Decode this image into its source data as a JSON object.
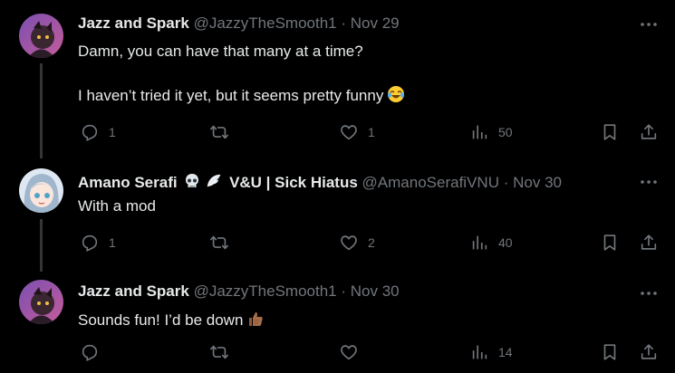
{
  "tweets": [
    {
      "name": "Jazz and Spark",
      "handle": "@JazzyTheSmooth1",
      "dot": "·",
      "date": "Nov 29",
      "text_lines": [
        "Damn, you can have that many at a time?",
        "I haven’t tried it yet, but it seems pretty funny"
      ],
      "replies": "1",
      "reposts": "",
      "likes": "1",
      "views": "50"
    },
    {
      "name": "Amano Serafi",
      "name_suffix": "V&U | Sick Hiatus",
      "handle": "@AmanoSerafiVNU",
      "dot": "·",
      "date": "Nov 30",
      "text_lines": [
        "With a mod"
      ],
      "replies": "1",
      "reposts": "",
      "likes": "2",
      "views": "40"
    },
    {
      "name": "Jazz and Spark",
      "handle": "@JazzyTheSmooth1",
      "dot": "·",
      "date": "Nov 30",
      "text_lines": [
        "Sounds fun! I’d be down"
      ],
      "replies": "",
      "reposts": "",
      "likes": "",
      "views": "14"
    }
  ],
  "icons": {
    "reply": "reply-icon",
    "repost": "repost-icon",
    "like": "heart-icon",
    "views": "analytics-icon",
    "bookmark": "bookmark-icon",
    "share": "share-icon",
    "more": "more-icon"
  },
  "colors": {
    "background": "#000000",
    "text": "#e7e9ea",
    "muted": "#71767b",
    "thread_line": "#333639"
  }
}
